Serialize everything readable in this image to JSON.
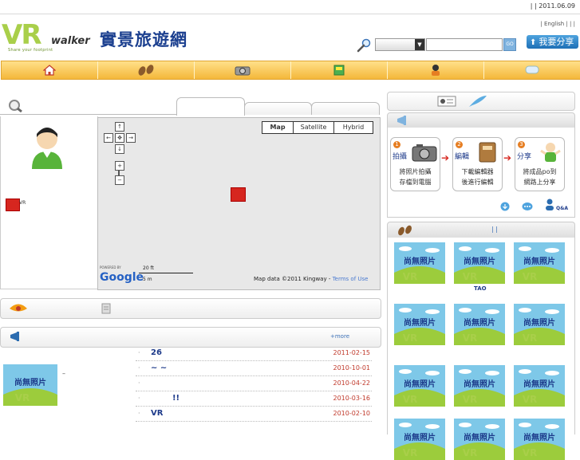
{
  "topbar": {
    "date_text": "|  | 2011.06.09"
  },
  "header": {
    "logo_vr": "VR",
    "logo_walker": "walker",
    "logo_tagline": "Share your footprint",
    "site_name": "實景旅遊網",
    "lang_links": "| English |   |   |",
    "search_placeholder": "",
    "go_label": "GO",
    "share_label": "我要分享"
  },
  "nav": {
    "items": [
      {
        "icon": "home-icon"
      },
      {
        "icon": "footprints-icon"
      },
      {
        "icon": "camera-icon"
      },
      {
        "icon": "map-book-icon"
      },
      {
        "icon": "person-icon"
      },
      {
        "icon": "chat-icon"
      }
    ]
  },
  "map": {
    "types": [
      "Map",
      "Satellite",
      "Hybrid"
    ],
    "scale_top": "20 ft",
    "scale_bottom": "5 m",
    "copyright": "Map data ©2011 Kingway - ",
    "terms": "Terms of Use",
    "powered_by": "POWERED BY",
    "google": "Google"
  },
  "profile": {
    "vr_label": "VR"
  },
  "news": {
    "more_label": "+more",
    "dash": "–",
    "items": [
      {
        "title": "26",
        "date": "2011-02-15"
      },
      {
        "title": "~    ~",
        "date": "2010-10-01"
      },
      {
        "title": "",
        "date": "2010-04-22"
      },
      {
        "title": "!!",
        "date": "2010-03-16"
      },
      {
        "title": "VR",
        "date": "2010-02-10"
      }
    ]
  },
  "steps": [
    {
      "num": "1",
      "label": "拍攝",
      "desc1": "將照片拍攝",
      "desc2": "存檔到電腦"
    },
    {
      "num": "2",
      "label": "編輯",
      "desc1": "下載編輯器",
      "desc2": "後進行編輯"
    },
    {
      "num": "3",
      "label": "分享",
      "desc1": "將成品po到",
      "desc2": "網路上分享"
    }
  ],
  "qa_label": "Q&A",
  "photos": {
    "placeholder_text": "尚無照片",
    "sublabel": "TAO",
    "header_sep": "|    |"
  },
  "colors": {
    "nav_top": "#ffe08a",
    "nav_bottom": "#f4b73a",
    "brand_blue": "#1b3f8f",
    "accent_green": "#a9cf4a",
    "date_red": "#c0392b"
  }
}
